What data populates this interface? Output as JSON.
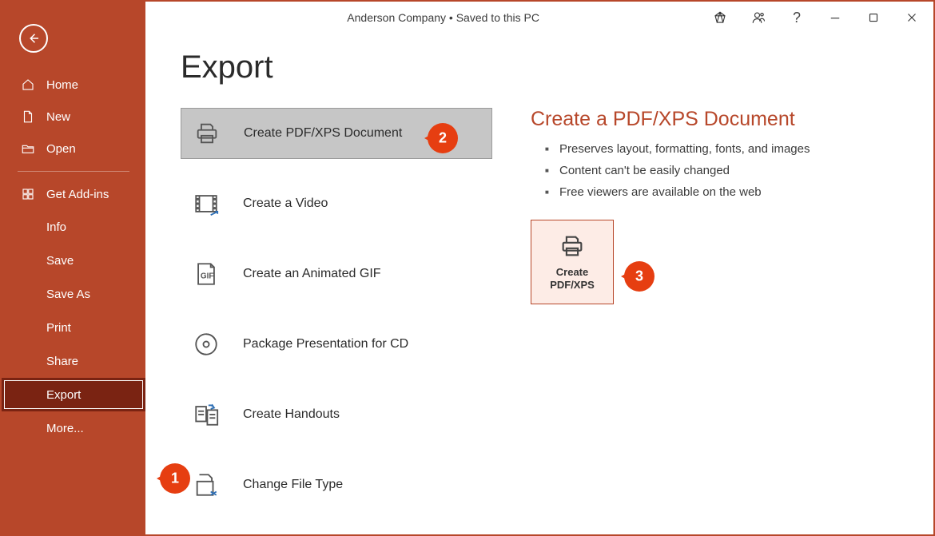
{
  "titlebar": {
    "document_title": "Anderson Company • Saved to this PC"
  },
  "sidebar": {
    "home": "Home",
    "new": "New",
    "open": "Open",
    "addins": "Get Add-ins",
    "info": "Info",
    "save": "Save",
    "saveas": "Save As",
    "print": "Print",
    "share": "Share",
    "export": "Export",
    "more": "More..."
  },
  "main": {
    "heading": "Export",
    "options": {
      "pdfxps": "Create PDF/XPS Document",
      "video": "Create a Video",
      "gif": "Create an Animated GIF",
      "package": "Package Presentation for CD",
      "handouts": "Create Handouts",
      "filetype": "Change File Type"
    },
    "detail": {
      "heading": "Create a PDF/XPS Document",
      "bullets": [
        "Preserves layout, formatting, fonts, and images",
        "Content can't be easily changed",
        "Free viewers are available on the web"
      ],
      "button_label": "Create\nPDF/XPS"
    }
  },
  "callouts": {
    "c1": "1",
    "c2": "2",
    "c3": "3"
  }
}
